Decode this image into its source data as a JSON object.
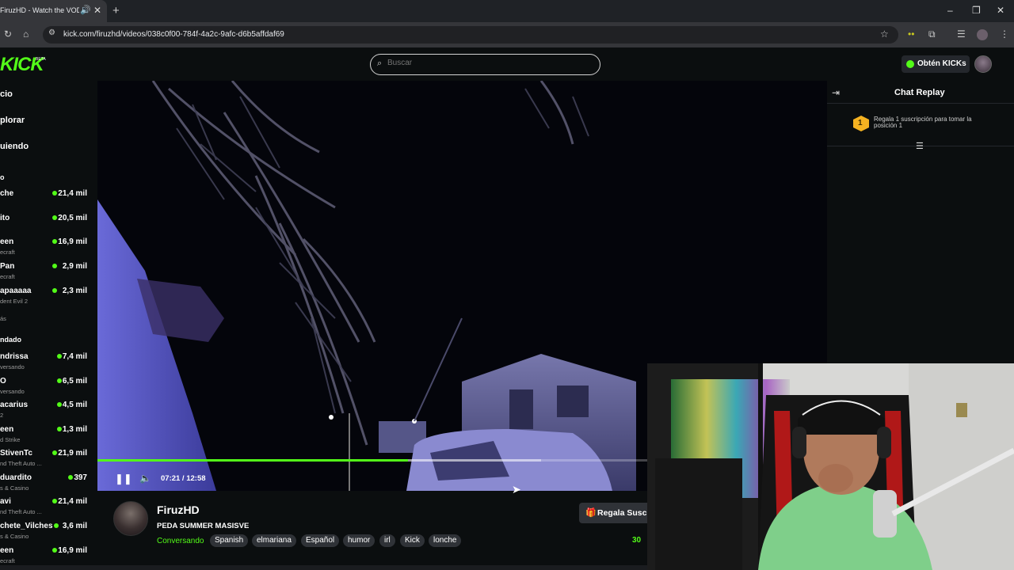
{
  "browser": {
    "tab_title": "FiruzHD - Watch the VOD o",
    "url": "kick.com/firuzhd/videos/038c0f00-784f-4a2c-9afc-d6b5affdaf69"
  },
  "header": {
    "logo": "KICK",
    "logo_badge": "BETA",
    "search_placeholder": "Buscar",
    "kicks_button": "Obtén KICKs"
  },
  "sidebar": {
    "nav": [
      "cio",
      "plorar",
      "uiendo"
    ],
    "section_recommended": "o",
    "recommended": [
      {
        "name": "che",
        "category": "",
        "viewers": "21,4 mil"
      },
      {
        "name": "ito",
        "category": "",
        "viewers": "20,5 mil"
      },
      {
        "name": "een",
        "category": "ecraft",
        "viewers": "16,9 mil"
      },
      {
        "name": "Pan",
        "category": "ecraft",
        "viewers": "2,9 mil"
      },
      {
        "name": "apaaaaa",
        "category": "dent Evil 2",
        "viewers": "2,3 mil"
      }
    ],
    "show_more": "ás",
    "section_following": "ndado",
    "following": [
      {
        "name": "ndrissa",
        "category": "versando",
        "viewers": "7,4 mil"
      },
      {
        "name": "O",
        "category": "versando",
        "viewers": "6,5 mil"
      },
      {
        "name": "acarius",
        "category": "2",
        "viewers": "4,5 mil"
      },
      {
        "name": "een",
        "category": "d Strike",
        "viewers": "1,3 mil"
      },
      {
        "name": "StivenTc",
        "category": "nd Theft Auto ...",
        "viewers": "21,9 mil"
      },
      {
        "name": "duardito",
        "category": "s & Casino",
        "viewers": "397"
      },
      {
        "name": "avi",
        "category": "nd Theft Auto ...",
        "viewers": "21,4 mil"
      },
      {
        "name": "chete_Vilches",
        "category": "s & Casino",
        "viewers": "3,6 mil"
      },
      {
        "name": "een",
        "category": "ecraft",
        "viewers": "16,9 mil"
      }
    ]
  },
  "player": {
    "time": "07:21 / 12:58",
    "progress": 0.565
  },
  "chat": {
    "title": "Chat Replay",
    "gift_rank": "1",
    "gift_text": "Regala 1 suscripción para tomar la posición 1"
  },
  "stream": {
    "streamer": "FiruzHD",
    "title": "PEDA SUMMER MASISVE",
    "category": "Conversando",
    "tags": [
      "Spanish",
      "elmariana",
      "Español",
      "humor",
      "irl",
      "Kick",
      "lonche"
    ],
    "gift_button": "Regala Susc",
    "viewers": "30"
  },
  "colors": {
    "accent": "#53fc18",
    "background": "#0b0e0f",
    "badge_gold": "#f5b221"
  }
}
